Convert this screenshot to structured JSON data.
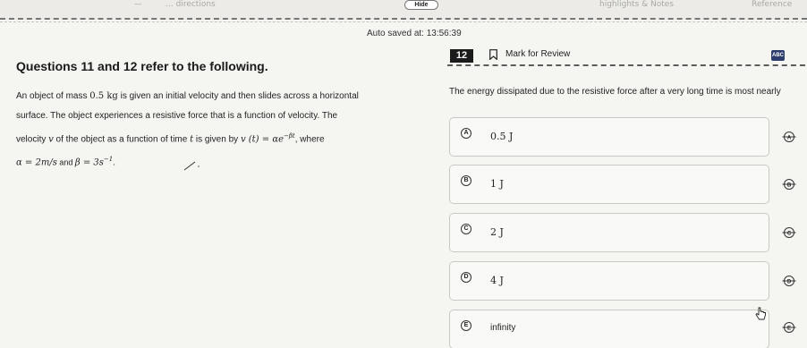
{
  "top_bar": {
    "hide_label": "Hide",
    "faded_left": "—         … directions",
    "faded_right_1": "highlights & Notes",
    "faded_right_2": "Reference"
  },
  "header": {
    "autosave": "Auto saved at: 13:56:39",
    "section_title": "Questions 11 and 12 refer to the following.",
    "question_number": "12",
    "mark_for_review": "Mark for Review",
    "strike_tool_label": "ABC"
  },
  "passage": {
    "line1_pre": "An object of mass ",
    "line1_mass": "0.5 kg",
    "line1_post": " is given an initial velocity and then slides across a horizontal",
    "line2": "surface. The object experiences a resistive force that is a function of velocity. The",
    "line3_pre": "velocity ",
    "line3_v": "v",
    "line3_mid": " of the object as a function of time ",
    "line3_t": "t",
    "line3_given": " is given by ",
    "line3_formula": "v (t) = αe",
    "line3_exp": "−βt",
    "line3_post": ", where",
    "line4_alpha": "α = 2m/s",
    "line4_and": " and ",
    "line4_beta": "β = 3s",
    "line4_beta_exp": "−1",
    "line4_end": "."
  },
  "question": {
    "text": "The energy dissipated due to the resistive force after a very long time is most nearly"
  },
  "choices": [
    {
      "letter": "A",
      "text": "0.5 J"
    },
    {
      "letter": "B",
      "text": "1 J"
    },
    {
      "letter": "C",
      "text": "2 J"
    },
    {
      "letter": "D",
      "text": "4 J"
    },
    {
      "letter": "E",
      "text": "infinity"
    }
  ],
  "colors": {
    "background": "#f5f5f2",
    "question_badge": "#1b1b1b",
    "abc_tool": "#2d3e6e",
    "choice_border": "#c9c9c4"
  }
}
